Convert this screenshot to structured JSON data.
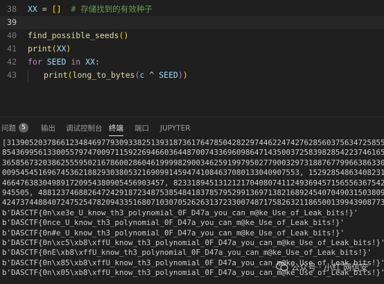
{
  "editor": {
    "lines": [
      {
        "num": "38",
        "tokens": [
          {
            "t": "XX",
            "c": "t-var"
          },
          {
            "t": " = ",
            "c": "t-op"
          },
          {
            "t": "[]",
            "c": "t-brk"
          },
          {
            "t": "  # 存储找到的有效种子",
            "c": "t-cmt"
          }
        ]
      },
      {
        "num": "39",
        "current": true,
        "tokens": []
      },
      {
        "num": "40",
        "tokens": [
          {
            "t": "find_possible_seeds",
            "c": "t-fn"
          },
          {
            "t": "()",
            "c": "t-brk"
          }
        ]
      },
      {
        "num": "41",
        "tokens": [
          {
            "t": "print",
            "c": "t-fn"
          },
          {
            "t": "(",
            "c": "t-brk"
          },
          {
            "t": "XX",
            "c": "t-var"
          },
          {
            "t": ")",
            "c": "t-brk"
          }
        ]
      },
      {
        "num": "42",
        "tokens": [
          {
            "t": "for",
            "c": "t-kw"
          },
          {
            "t": " ",
            "c": "t-op"
          },
          {
            "t": "SEED",
            "c": "t-var"
          },
          {
            "t": " ",
            "c": "t-op"
          },
          {
            "t": "in",
            "c": "t-kw"
          },
          {
            "t": " ",
            "c": "t-op"
          },
          {
            "t": "XX",
            "c": "t-var"
          },
          {
            "t": ":",
            "c": "t-op"
          }
        ]
      },
      {
        "num": "43",
        "indent": true,
        "tokens": [
          {
            "t": "print",
            "c": "t-fn"
          },
          {
            "t": "(",
            "c": "t-brk"
          },
          {
            "t": "long_to_bytes",
            "c": "t-fn"
          },
          {
            "t": "(",
            "c": "t-paren"
          },
          {
            "t": "c",
            "c": "t-var"
          },
          {
            "t": " ^ ",
            "c": "t-op"
          },
          {
            "t": "SEED",
            "c": "t-var"
          },
          {
            "t": ")",
            "c": "t-paren"
          },
          {
            "t": ")",
            "c": "t-brk"
          }
        ]
      }
    ]
  },
  "panel": {
    "tabs": [
      {
        "label": "问题",
        "badge": "5"
      },
      {
        "label": "输出"
      },
      {
        "label": "调试控制台"
      },
      {
        "label": "终端",
        "active": true
      },
      {
        "label": "端口"
      },
      {
        "label": "JUPYTER"
      }
    ]
  },
  "terminal": {
    "lines": [
      "[31390520378661234846977930933825139318736176478504282297446224742762856037563472585534285",
      "854369956133005579747009711592269466036448700743369609864714350037258398285422374616540503",
      "365856732038625559502167860028604619999829003462591997950277900329731887677996638633085378",
      "009545451696745362188293038053216909914594741084637080133040907553, 152928548634082315429372",
      "466476383049891720954380905456903457, 823318945131212170408074112493694571565563675428506972",
      "945505, 488123746882647242918723487538548418378579529913697138216892454070490315038098269862",
      "424737448840724752547820943351680710307052626313723300748717582632118650013994390877304374666",
      "b'DASCTF{0n\\xe3e_U_know_th3_polynomial_0F_D47a_you_can_m@ke_Use_of_Leak_bits!}'",
      "b'DASCTF{0nce_U_know_th3_polynomial_0F_D47a_you_can_m@ke_Use_of_Leak_bits!}'",
      "b'DASCTF{0n#e_U_know_th3_polynomial_0F_D47a_you_can_m@ke_Use_of_Leak_bits!}'",
      "b'DASCTF{0n\\xc5\\xb8\\xffU_know_th3_polynomial_0F_D47a_you_can_m@ke_Use_of_Leak_bits!}'",
      "b'DASCTF{0nE\\xb8\\xffU_know_th3_polynomial_0F_D47a_you_can_m@ke_Use_of_Leak_bits!}'",
      "b'DASCTF{0n\\x85\\xb8\\xffU_know_th3_polynomial_0F_D47a_you_can_m@ke_Use_of_Leak_bits!}'",
      "b'DASCTF{0n\\x05\\xb8\\xffU_know_th3_polynomial_0F_D47a_you_can_m@ke_Use_of_Leak_bits!}'"
    ]
  },
  "watermark": {
    "text": "公众号 · 小红 网信安",
    "icon": "wechat-icon"
  }
}
